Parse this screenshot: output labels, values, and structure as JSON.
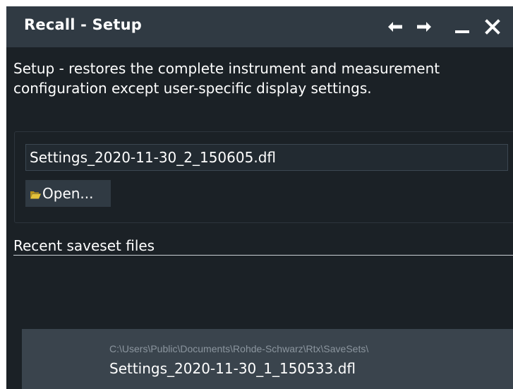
{
  "window": {
    "title": "Recall - Setup",
    "controls": [
      "back-arrow-icon",
      "forward-arrow-icon",
      "minimize-icon",
      "close-icon"
    ]
  },
  "description": "Setup - restores the complete instrument and measurement configuration except user-specific display settings.",
  "file": {
    "path_value": "Settings_2020-11-30_2_150605.dfl",
    "open_label": "Open...",
    "open_icon": "folder-icon"
  },
  "recent": {
    "header": "Recent saveset files",
    "items": [
      {
        "path": "C:\\Users\\Public\\Documents\\Rohde-Schwarz\\Rtx\\SaveSets\\",
        "name": "Settings_2020-11-30_1_150533.dfl"
      }
    ]
  },
  "colors": {
    "window_bg": "#1b2126",
    "titlebar_bg": "#303a43",
    "button_bg": "#303a43",
    "list_item_bg": "#3a444d",
    "path_text": "#8b959e",
    "folder_icon": "#d8b32c"
  }
}
